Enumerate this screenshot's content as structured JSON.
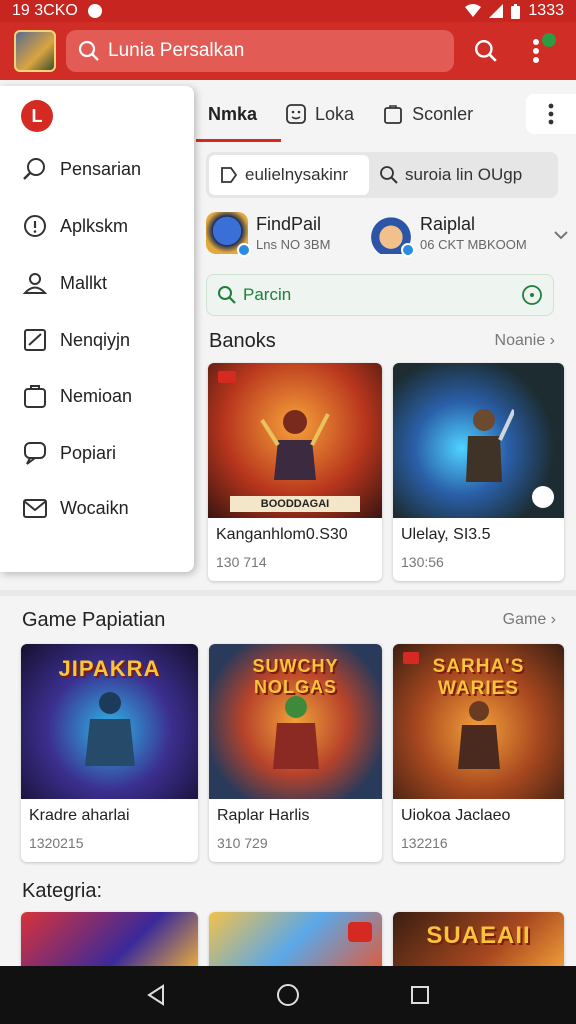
{
  "status": {
    "time": "19 3CKO",
    "right": "1333"
  },
  "search": {
    "placeholder": "Lunia Persalkan"
  },
  "drawer": {
    "logo": "L",
    "items": [
      {
        "label": "Pensarian",
        "icon": "search-icon"
      },
      {
        "label": "Aplkskm",
        "icon": "info-icon"
      },
      {
        "label": "Mallkt",
        "icon": "person-icon"
      },
      {
        "label": "Nenqiyjn",
        "icon": "chart-icon"
      },
      {
        "label": "Nemioan",
        "icon": "bag-icon"
      },
      {
        "label": "Popiari",
        "icon": "chat-icon"
      },
      {
        "label": "Wocaikn",
        "icon": "mail-icon"
      }
    ]
  },
  "tabs": [
    {
      "label": "Nmka",
      "icon": ""
    },
    {
      "label": "Loka",
      "icon": "smile-icon"
    },
    {
      "label": "Sconler",
      "icon": "bag-icon"
    }
  ],
  "chips": [
    {
      "label": "eulielnysakinr",
      "icon": "tag-icon"
    },
    {
      "label": "suroia lin OUgp",
      "icon": "search-icon"
    }
  ],
  "featured": [
    {
      "name": "FindPail",
      "sub": "Lns NO 3BM"
    },
    {
      "name": "Raiplal",
      "sub": "06 CKT MBKOOM"
    }
  ],
  "green_search": {
    "label": "Parcin"
  },
  "section1": {
    "title": "Banoks",
    "more": "Noanie",
    "cards": [
      {
        "title": "Kanganhlom0.S30",
        "sub": "130 714",
        "art_label": "BOODDAGAI"
      },
      {
        "title": "Ulelay, SI3.5",
        "sub": "130:56",
        "art_label": ""
      }
    ]
  },
  "section2": {
    "title": "Game Papiatian",
    "more": "Game",
    "cards": [
      {
        "title": "Kradre aharlai",
        "sub": "1320215",
        "art_label": "JIPAKRA"
      },
      {
        "title": "Raplar Harlis",
        "sub": "310 729",
        "art_label": "SUWCHY NOLGAS"
      },
      {
        "title": "Uiokoa Jaclaeo",
        "sub": "132216",
        "art_label": "SARHA'S WARIES"
      }
    ]
  },
  "section3": {
    "title": "Kategria:",
    "cards": [
      {
        "art_label": ""
      },
      {
        "art_label": ""
      },
      {
        "art_label": "SUAEAII"
      }
    ]
  },
  "colors": {
    "brand": "#cf2d26",
    "status": "#c6261f",
    "accent_green": "#1f7f3a"
  }
}
